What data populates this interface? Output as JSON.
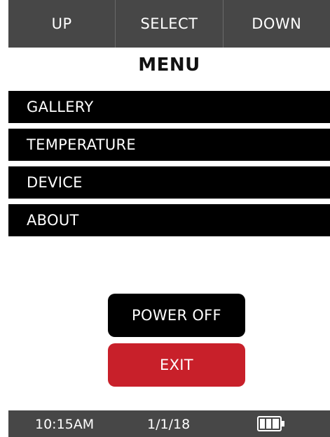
{
  "softkeys": {
    "up": "UP",
    "select": "SELECT",
    "down": "DOWN"
  },
  "menu": {
    "title": "MENU",
    "items": [
      {
        "label": "GALLERY"
      },
      {
        "label": "TEMPERATURE"
      },
      {
        "label": "DEVICE"
      },
      {
        "label": "ABOUT"
      }
    ]
  },
  "buttons": {
    "power_off": "POWER OFF",
    "exit": "EXIT"
  },
  "status": {
    "time": "10:15AM",
    "date": "1/1/18",
    "battery_icon": "battery-full-icon",
    "battery_level": 1.0
  },
  "colors": {
    "bar_background": "#474747",
    "menu_item_background": "#000000",
    "exit_button": "#c8202a",
    "power_button": "#000000"
  }
}
